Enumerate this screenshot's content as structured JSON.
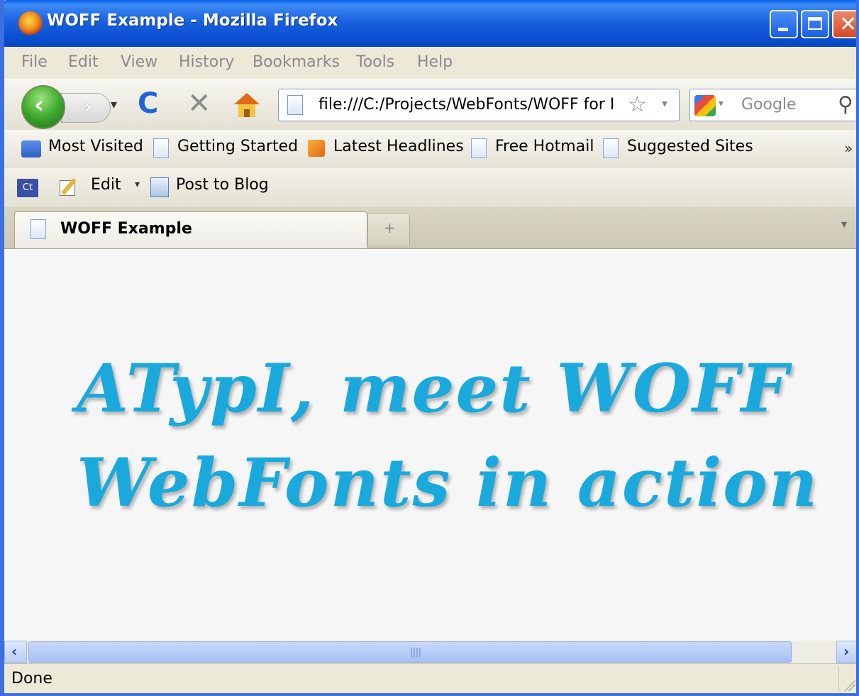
{
  "window": {
    "title": "WOFF Example - Mozilla Firefox",
    "close_glyph": "✕"
  },
  "menu": {
    "items": [
      "File",
      "Edit",
      "View",
      "History",
      "Bookmarks",
      "Tools",
      "Help"
    ]
  },
  "nav": {
    "back_glyph": "‹",
    "forward_glyph": "›",
    "history_dropdown_glyph": "▾",
    "reload_glyph": "C",
    "stop_glyph": "✕",
    "url": "file:///C:/Projects/WebFonts/WOFF for I",
    "bookmark_star_glyph": "☆",
    "url_dropdown_glyph": "▾",
    "search_dropdown_glyph": "▾",
    "search_placeholder": "Google",
    "search_icon_glyph": "⚲"
  },
  "bookmarks": {
    "items": [
      "Most Visited",
      "Getting Started",
      "Latest Headlines",
      "Free Hotmail",
      "Suggested Sites"
    ],
    "chevron": "»"
  },
  "addon_toolbar": {
    "ct_label": "Ct",
    "edit_label": "Edit",
    "edit_dropdown_glyph": "▾",
    "post_label": "Post to Blog"
  },
  "tabs": {
    "active_title": "WOFF Example",
    "new_tab_glyph": "+",
    "tab_list_glyph": "▾"
  },
  "content": {
    "headline_line1": "ATypI, meet WOFF",
    "headline_line2": "WebFonts in action",
    "text_color": "#1aa9dc"
  },
  "scrollbar": {
    "left_glyph": "‹",
    "right_glyph": "›"
  },
  "status": {
    "text": "Done"
  }
}
